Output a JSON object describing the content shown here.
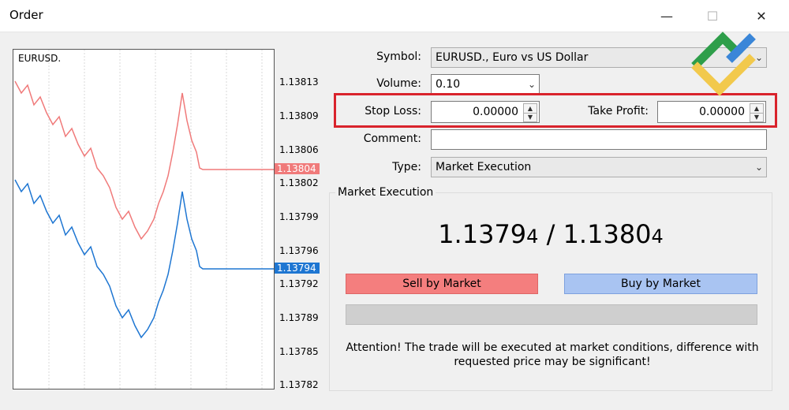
{
  "window": {
    "title": "Order",
    "minimize_icon": "—",
    "maximize_icon": "☐",
    "close_icon": "✕"
  },
  "chart": {
    "symbol": "EURUSD.",
    "y_ticks": [
      "1.13813",
      "1.13809",
      "1.13806",
      "1.13802",
      "1.13799",
      "1.13796",
      "1.13792",
      "1.13789",
      "1.13785",
      "1.13782"
    ],
    "ask_tag": "1.13804",
    "bid_tag": "1.13794",
    "ask_color": "#f07a7a",
    "bid_color": "#1e76d2"
  },
  "form": {
    "symbol_label": "Symbol:",
    "symbol_value": "EURUSD., Euro vs US Dollar",
    "volume_label": "Volume:",
    "volume_value": "0.10",
    "stoploss_label": "Stop Loss:",
    "stoploss_value": "0.00000",
    "takeprofit_label": "Take Profit:",
    "takeprofit_value": "0.00000",
    "comment_label": "Comment:",
    "comment_value": "",
    "type_label": "Type:",
    "type_value": "Market Execution"
  },
  "market": {
    "group_label": "Market Execution",
    "bid_main": "1.1379",
    "bid_small": "4",
    "separator": " / ",
    "ask_main": "1.1380",
    "ask_small": "4",
    "sell_label": "Sell by Market",
    "buy_label": "Buy by Market",
    "sell_color": "#f47e7e",
    "buy_color": "#a9c4f2",
    "attention_line1": "Attention! The trade will be executed at market conditions, difference with",
    "attention_line2": "requested price may be significant!"
  },
  "icons": {
    "dropdown": "chevron-down-icon",
    "spinner": "spin-arrows-icon",
    "logo": "brand-logo-icon"
  }
}
